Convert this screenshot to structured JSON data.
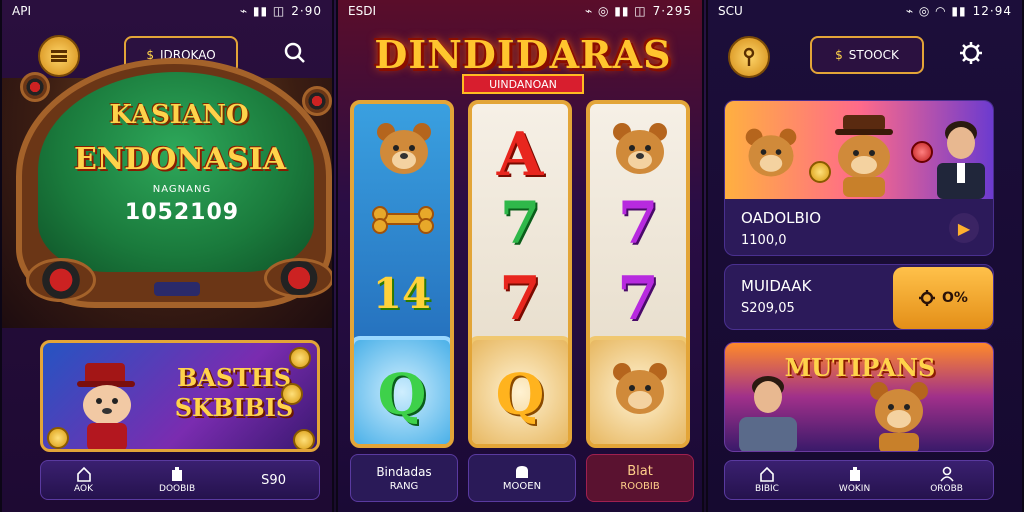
{
  "phone_left": {
    "status": {
      "left": "API",
      "right": "2·90"
    },
    "header": {
      "menu_icon": "hamburger-icon",
      "pill_label": "IDROKAO",
      "pill_icon": "dollar-icon",
      "search_icon": "search-icon"
    },
    "hero": {
      "title_line1": "KASIANO",
      "title_line2": "ENDONASIA",
      "subtitle": "NAGNANG",
      "number": "1052109"
    },
    "banner": {
      "title_line1": "BASTHS",
      "title_line2": "SKBIBIS"
    },
    "nav": [
      {
        "label": "AOK",
        "icon": "home-icon"
      },
      {
        "label": "DOOBIB",
        "icon": "tag-icon"
      },
      {
        "label": "S90",
        "icon": ""
      }
    ]
  },
  "phone_middle": {
    "status": {
      "left": "ESDI",
      "right": "7·295"
    },
    "title": "DINDIDARAS",
    "subtitle": "UINDANOAN",
    "reels": [
      [
        "bear",
        "bone",
        "14",
        "Q"
      ],
      [
        "A",
        "7",
        "7",
        "Q"
      ],
      [
        "bear",
        "7",
        "7",
        "bear"
      ]
    ],
    "tabs": [
      {
        "line1": "Bindadas",
        "line2": "RANG"
      },
      {
        "line1": "",
        "line2": "MOOEN",
        "icon": "toast-icon"
      },
      {
        "line1": "Blat",
        "line2": "ROOBIB"
      }
    ]
  },
  "phone_right": {
    "status": {
      "left": "SCU",
      "right": "12·94"
    },
    "header": {
      "menu_icon": "key-icon",
      "pill_label": "STOOCK",
      "pill_icon": "dollar-icon",
      "settings_icon": "gear-icon"
    },
    "card1": {
      "title": "OADOLBIO",
      "value": "1100,0"
    },
    "card2": {
      "title": "MUIDAAK",
      "value": "S209,05",
      "button_label": "O%"
    },
    "banner": {
      "title": "MUTIPANS"
    },
    "nav": [
      {
        "label": "BIBIC",
        "icon": "home-icon"
      },
      {
        "label": "WOKIN",
        "icon": "tag-icon"
      },
      {
        "label": "OROBB",
        "icon": "user-icon"
      }
    ]
  },
  "colors": {
    "gold": "#e3a538",
    "title_yellow": "#ffd34a",
    "felt_green": "#1a7a3c",
    "purple": "#2b1140"
  }
}
